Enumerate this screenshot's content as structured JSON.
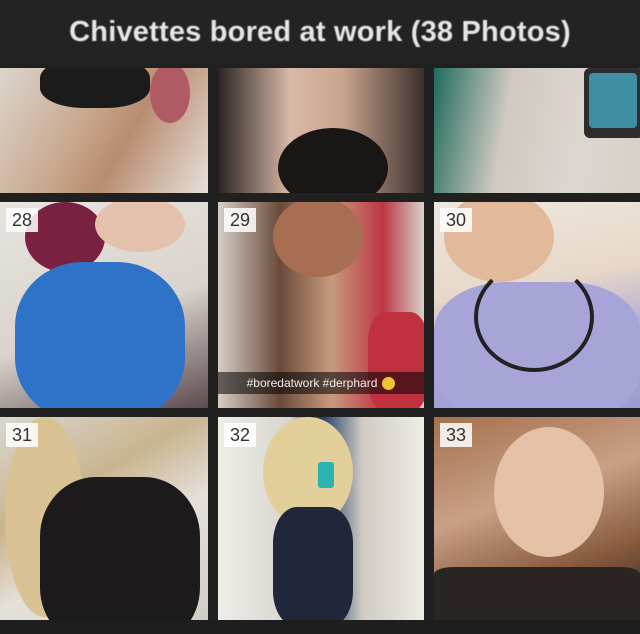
{
  "header": {
    "title": "Chivettes bored at work (38 Photos)"
  },
  "tiles": [
    {
      "number": ""
    },
    {
      "number": ""
    },
    {
      "number": ""
    },
    {
      "number": "28"
    },
    {
      "number": "29",
      "caption": "#boredatwork #derphard"
    },
    {
      "number": "30"
    },
    {
      "number": "31"
    },
    {
      "number": "32"
    },
    {
      "number": "33"
    }
  ]
}
